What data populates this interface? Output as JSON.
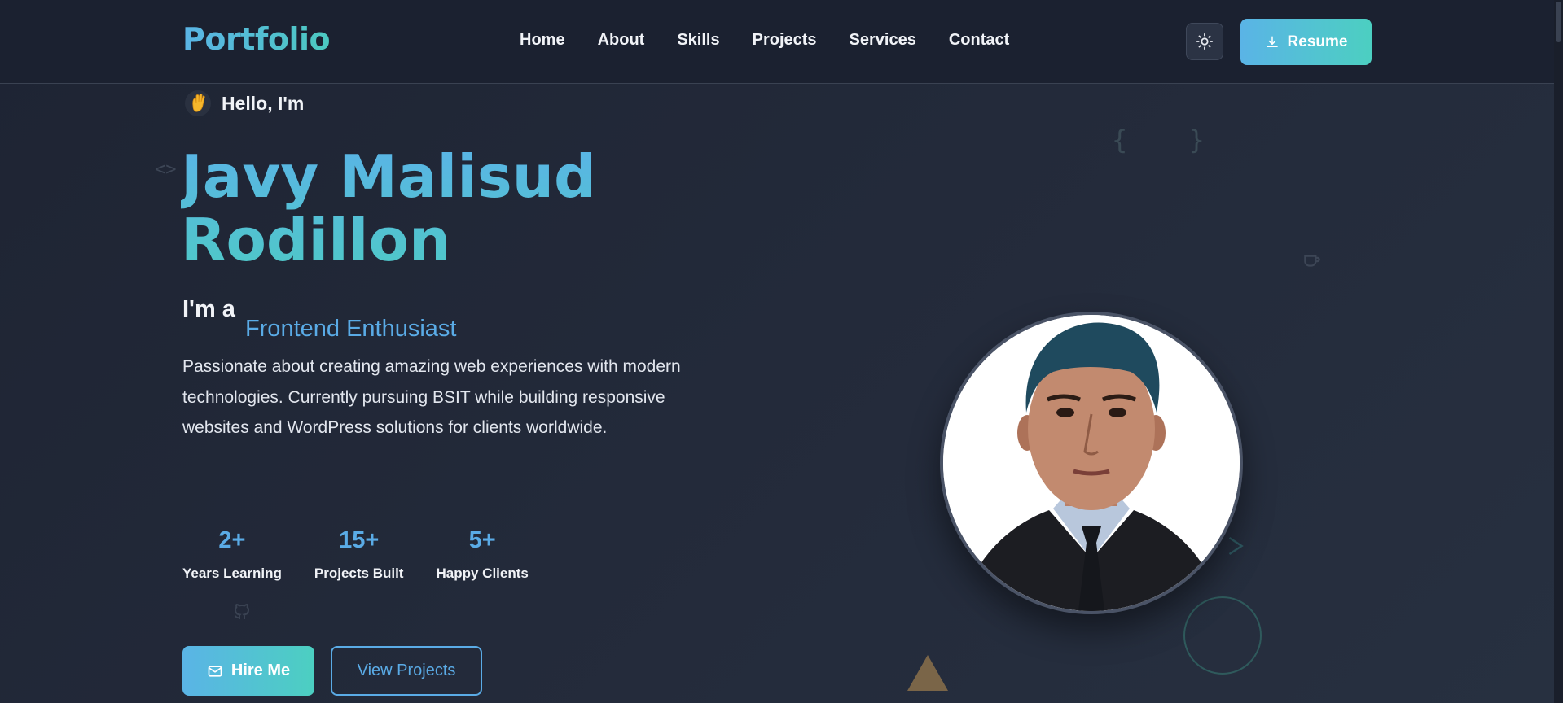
{
  "brand": {
    "logo": "Portfolio",
    "accent_start": "#5ab4e6",
    "accent_end": "#4ccfc1"
  },
  "nav": {
    "items": [
      "Home",
      "About",
      "Skills",
      "Projects",
      "Services",
      "Contact"
    ]
  },
  "header": {
    "theme_icon": "sun-icon",
    "resume_label": "Resume",
    "resume_icon": "download-icon"
  },
  "hero": {
    "greeting": "Hello, I'm",
    "greeting_icon": "waving-hand-icon",
    "name_line1": "Javy Malisud",
    "name_line2": "Rodillon",
    "role_prefix": "I'm a",
    "role": "Frontend Enthusiast",
    "description": "Passionate about creating amazing web experiences with modern technologies. Currently pursuing BSIT while building responsive websites and WordPress solutions for clients worldwide.",
    "stats": [
      {
        "value": "2+",
        "label": "Years Learning"
      },
      {
        "value": "15+",
        "label": "Projects Built"
      },
      {
        "value": "5+",
        "label": "Happy Clients"
      }
    ],
    "hire_label": "Hire Me",
    "hire_icon": "mail-icon",
    "projects_label": "View Projects",
    "avatar": "profile-photo"
  },
  "decorations": {
    "code_tag": "<>",
    "braces": "{ }"
  }
}
